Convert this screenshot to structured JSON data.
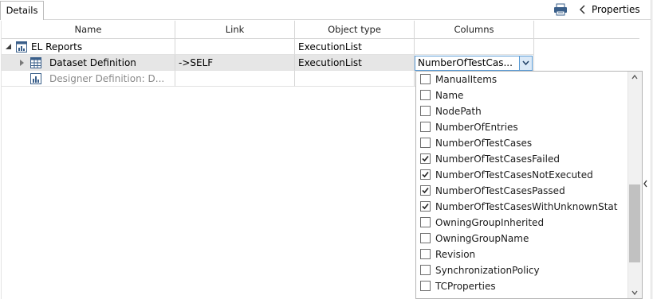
{
  "tabs": {
    "details": "Details"
  },
  "toolbar": {
    "properties_label": "Properties"
  },
  "columns": [
    "Name",
    "Link",
    "Object type",
    "Columns"
  ],
  "rows": [
    {
      "name": "EL Reports",
      "link": "",
      "object_type": "ExecutionList",
      "columns": ""
    },
    {
      "name": "Dataset Definition",
      "link": "->SELF",
      "object_type": "ExecutionList",
      "columns": "NumberOfTestCas..."
    },
    {
      "name": "Designer Definition: D...",
      "link": "",
      "object_type": "",
      "columns": ""
    }
  ],
  "dropdown": {
    "options": [
      {
        "label": "ManualItems",
        "checked": false
      },
      {
        "label": "Name",
        "checked": false
      },
      {
        "label": "NodePath",
        "checked": false
      },
      {
        "label": "NumberOfEntries",
        "checked": false
      },
      {
        "label": "NumberOfTestCases",
        "checked": false
      },
      {
        "label": "NumberOfTestCasesFailed",
        "checked": true
      },
      {
        "label": "NumberOfTestCasesNotExecuted",
        "checked": true
      },
      {
        "label": "NumberOfTestCasesPassed",
        "checked": true
      },
      {
        "label": "NumberOfTestCasesWithUnknownStat",
        "checked": true
      },
      {
        "label": "OwningGroupInherited",
        "checked": false
      },
      {
        "label": "OwningGroupName",
        "checked": false
      },
      {
        "label": "Revision",
        "checked": false
      },
      {
        "label": "SynchronizationPolicy",
        "checked": false
      },
      {
        "label": "TCProperties",
        "checked": false
      }
    ]
  },
  "colors": {
    "selection": "#e6e6e6",
    "accent": "#5a9bd5"
  }
}
